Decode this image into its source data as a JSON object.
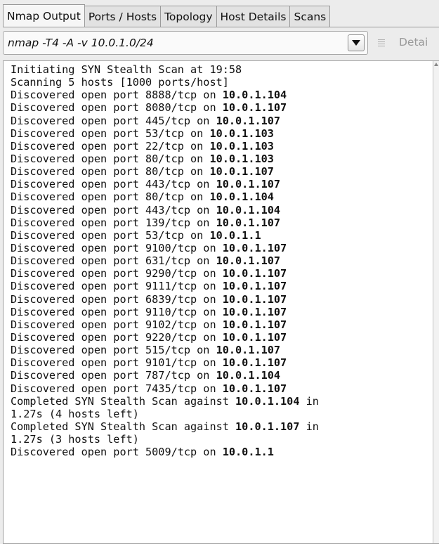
{
  "tabs": [
    {
      "label": "Nmap Output",
      "active": true
    },
    {
      "label": "Ports / Hosts",
      "active": false
    },
    {
      "label": "Topology",
      "active": false
    },
    {
      "label": "Host Details",
      "active": false
    },
    {
      "label": "Scans",
      "active": false
    }
  ],
  "command": {
    "value": "nmap -T4 -A -v 10.0.1.0/24",
    "details_label": "Detai"
  },
  "output": [
    {
      "pre": "Initiating SYN Stealth Scan at 19:58",
      "host": "",
      "post": ""
    },
    {
      "pre": "Scanning 5 hosts [1000 ports/host]",
      "host": "",
      "post": ""
    },
    {
      "pre": "Discovered open port 8888/tcp on ",
      "host": "10.0.1.104",
      "post": ""
    },
    {
      "pre": "Discovered open port 8080/tcp on ",
      "host": "10.0.1.107",
      "post": ""
    },
    {
      "pre": "Discovered open port 445/tcp on ",
      "host": "10.0.1.107",
      "post": ""
    },
    {
      "pre": "Discovered open port 53/tcp on ",
      "host": "10.0.1.103",
      "post": ""
    },
    {
      "pre": "Discovered open port 22/tcp on ",
      "host": "10.0.1.103",
      "post": ""
    },
    {
      "pre": "Discovered open port 80/tcp on ",
      "host": "10.0.1.103",
      "post": ""
    },
    {
      "pre": "Discovered open port 80/tcp on ",
      "host": "10.0.1.107",
      "post": ""
    },
    {
      "pre": "Discovered open port 443/tcp on ",
      "host": "10.0.1.107",
      "post": ""
    },
    {
      "pre": "Discovered open port 80/tcp on ",
      "host": "10.0.1.104",
      "post": ""
    },
    {
      "pre": "Discovered open port 443/tcp on ",
      "host": "10.0.1.104",
      "post": ""
    },
    {
      "pre": "Discovered open port 139/tcp on ",
      "host": "10.0.1.107",
      "post": ""
    },
    {
      "pre": "Discovered open port 53/tcp on ",
      "host": "10.0.1.1",
      "post": ""
    },
    {
      "pre": "Discovered open port 9100/tcp on ",
      "host": "10.0.1.107",
      "post": ""
    },
    {
      "pre": "Discovered open port 631/tcp on ",
      "host": "10.0.1.107",
      "post": ""
    },
    {
      "pre": "Discovered open port 9290/tcp on ",
      "host": "10.0.1.107",
      "post": ""
    },
    {
      "pre": "Discovered open port 9111/tcp on ",
      "host": "10.0.1.107",
      "post": ""
    },
    {
      "pre": "Discovered open port 6839/tcp on ",
      "host": "10.0.1.107",
      "post": ""
    },
    {
      "pre": "Discovered open port 9110/tcp on ",
      "host": "10.0.1.107",
      "post": ""
    },
    {
      "pre": "Discovered open port 9102/tcp on ",
      "host": "10.0.1.107",
      "post": ""
    },
    {
      "pre": "Discovered open port 9220/tcp on ",
      "host": "10.0.1.107",
      "post": ""
    },
    {
      "pre": "Discovered open port 515/tcp on ",
      "host": "10.0.1.107",
      "post": ""
    },
    {
      "pre": "Discovered open port 9101/tcp on ",
      "host": "10.0.1.107",
      "post": ""
    },
    {
      "pre": "Discovered open port 787/tcp on ",
      "host": "10.0.1.104",
      "post": ""
    },
    {
      "pre": "Discovered open port 7435/tcp on ",
      "host": "10.0.1.107",
      "post": ""
    },
    {
      "pre": "Completed SYN Stealth Scan against ",
      "host": "10.0.1.104",
      "post": " in"
    },
    {
      "pre": "1.27s (4 hosts left)",
      "host": "",
      "post": ""
    },
    {
      "pre": "Completed SYN Stealth Scan against ",
      "host": "10.0.1.107",
      "post": " in"
    },
    {
      "pre": "1.27s (3 hosts left)",
      "host": "",
      "post": ""
    },
    {
      "pre": "Discovered open port 5009/tcp on ",
      "host": "10.0.1.1",
      "post": ""
    }
  ]
}
